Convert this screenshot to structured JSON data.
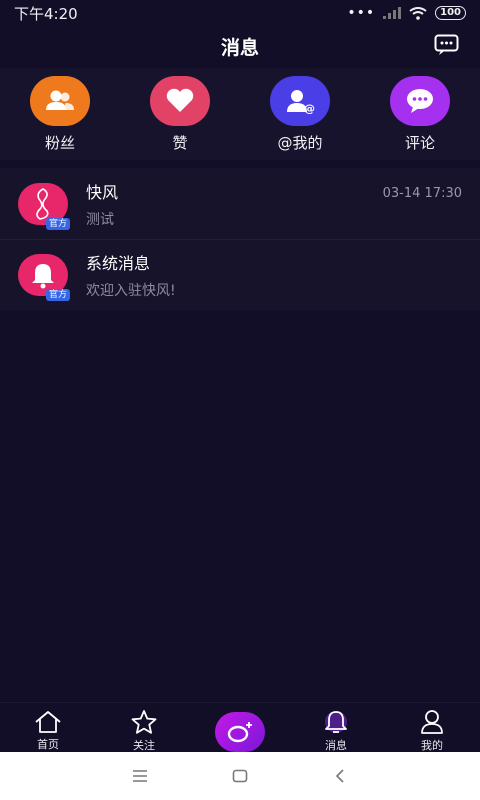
{
  "status_bar": {
    "time": "下午4:20",
    "battery": "100"
  },
  "header": {
    "title": "消息",
    "action_icon": "chat-more-icon"
  },
  "quick_actions": [
    {
      "label": "粉丝",
      "icon": "fans-icon",
      "color": "#ef7a1d"
    },
    {
      "label": "赞",
      "icon": "heart-icon",
      "color": "#e24265"
    },
    {
      "label": "@我的",
      "icon": "mention-icon",
      "color": "#4a3fe6"
    },
    {
      "label": "评论",
      "icon": "comment-icon",
      "color": "#a530f0"
    }
  ],
  "messages": [
    {
      "name": "快风",
      "preview": "测试",
      "time": "03-14 17:30",
      "badge": "官方",
      "avatar_icon": "figure-icon"
    },
    {
      "name": "系统消息",
      "preview": "欢迎入驻快风!",
      "time": "",
      "badge": "官方",
      "avatar_icon": "bell-icon"
    }
  ],
  "tab_bar": [
    {
      "label": "首页",
      "icon": "home-icon"
    },
    {
      "label": "关注",
      "icon": "star-icon"
    },
    {
      "label": "",
      "icon": "add-post-icon"
    },
    {
      "label": "消息",
      "icon": "bell-icon",
      "active": true
    },
    {
      "label": "我的",
      "icon": "profile-icon"
    }
  ],
  "colors": {
    "background": "#120e27",
    "accent": "#b41ee8",
    "badge": "#3566e8"
  }
}
